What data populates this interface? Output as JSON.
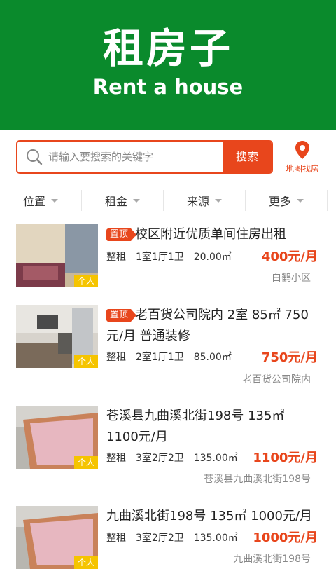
{
  "header": {
    "title": "租房子",
    "subtitle": "Rent a house"
  },
  "search": {
    "placeholder": "请输入要搜索的关键字",
    "button_label": "搜索",
    "map_label": "地图找房"
  },
  "filters": [
    {
      "label": "位置"
    },
    {
      "label": "租金"
    },
    {
      "label": "来源"
    },
    {
      "label": "更多"
    }
  ],
  "listings": [
    {
      "top_badge": "置顶",
      "title": "校区附近优质单间住房出租",
      "rent_type": "整租",
      "layout": "1室1厅1卫",
      "area": "20.00㎡",
      "price": "400元/月",
      "location": "白鹤小区",
      "source_tag": "个人"
    },
    {
      "top_badge": "置顶",
      "title": "老百货公司院内 2室 85㎡ 750元/月 普通装修",
      "rent_type": "整租",
      "layout": "2室1厅1卫",
      "area": "85.00㎡",
      "price": "750元/月",
      "location": "老百货公司院内",
      "source_tag": "个人"
    },
    {
      "top_badge": "",
      "title": "苍溪县九曲溪北街198号 135㎡ 1100元/月",
      "rent_type": "整租",
      "layout": "3室2厅2卫",
      "area": "135.00㎡",
      "price": "1100元/月",
      "location": "苍溪县九曲溪北街198号",
      "source_tag": "个人"
    },
    {
      "top_badge": "",
      "title": "九曲溪北街198号 135㎡ 1000元/月",
      "rent_type": "整租",
      "layout": "3室2厅2卫",
      "area": "135.00㎡",
      "price": "1000元/月",
      "location": "九曲溪北街198号",
      "source_tag": "个人"
    }
  ],
  "colors": {
    "brand_green": "#0a8a2c",
    "accent_orange": "#e8461c",
    "tag_yellow": "#f5c400"
  }
}
